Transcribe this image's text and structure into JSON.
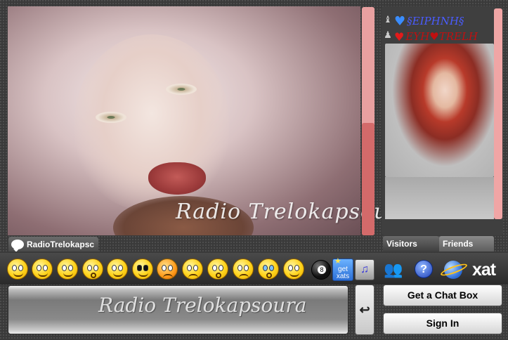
{
  "chat": {
    "background_watermark": "Radio  Trelokapsoura",
    "name_tab": "RadioTrelokapsc"
  },
  "users": [
    {
      "rank_icon": "♝",
      "heart_icon": "♥",
      "name": "§EIPHNH§"
    },
    {
      "rank_icon": "♟",
      "heart_icon": "♥",
      "name": "EYH♥TRELH"
    }
  ],
  "tabs": {
    "visitors": "Visitors",
    "friends": "Friends"
  },
  "toolbar": {
    "smileys": [
      "smile",
      "biggrin",
      "wink",
      "surprised",
      "smile",
      "cool",
      "mad",
      "confused",
      "eek",
      "sad",
      "cry",
      "redface"
    ],
    "get_xats_label_1": "get",
    "get_xats_label_2": "xats",
    "eightball_label": "8",
    "sound_icon": "♫",
    "users_icon": "👥",
    "help_label": "?",
    "logo_text": "xat"
  },
  "input": {
    "watermark": "Radio  Trelokapsoura",
    "send_icon": "↩"
  },
  "buttons": {
    "get_chat_box": "Get a Chat Box",
    "sign_in": "Sign In"
  },
  "colors": {
    "scrollbar": "#e8a0a0",
    "scroll_thumb": "#d36a6a",
    "accent_blue": "#4a5cff",
    "accent_red": "#c01010"
  }
}
